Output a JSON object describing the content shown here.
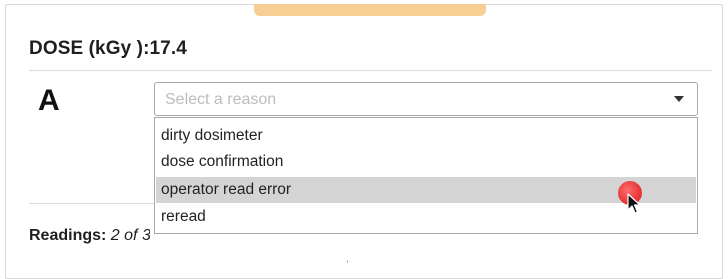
{
  "dose": {
    "label": "DOSE (kGy ):",
    "value": "17.4"
  },
  "grade": "A",
  "reason_select": {
    "placeholder": "Select a reason",
    "options": [
      {
        "label": "dirty dosimeter"
      },
      {
        "label": "dose confirmation"
      },
      {
        "label": "operator read error",
        "highlighted": true
      },
      {
        "label": "reread"
      }
    ]
  },
  "readings": {
    "label": "Readings:",
    "current": "2",
    "of_word": "of",
    "total": "3"
  },
  "colors": {
    "top_tab": "#f6cf95",
    "highlight": "#d4d4d4",
    "cursor_dot": "#ea3b3b"
  },
  "icons": {
    "dropdown": "caret-down-icon",
    "pointer": "mouse-pointer-icon"
  }
}
